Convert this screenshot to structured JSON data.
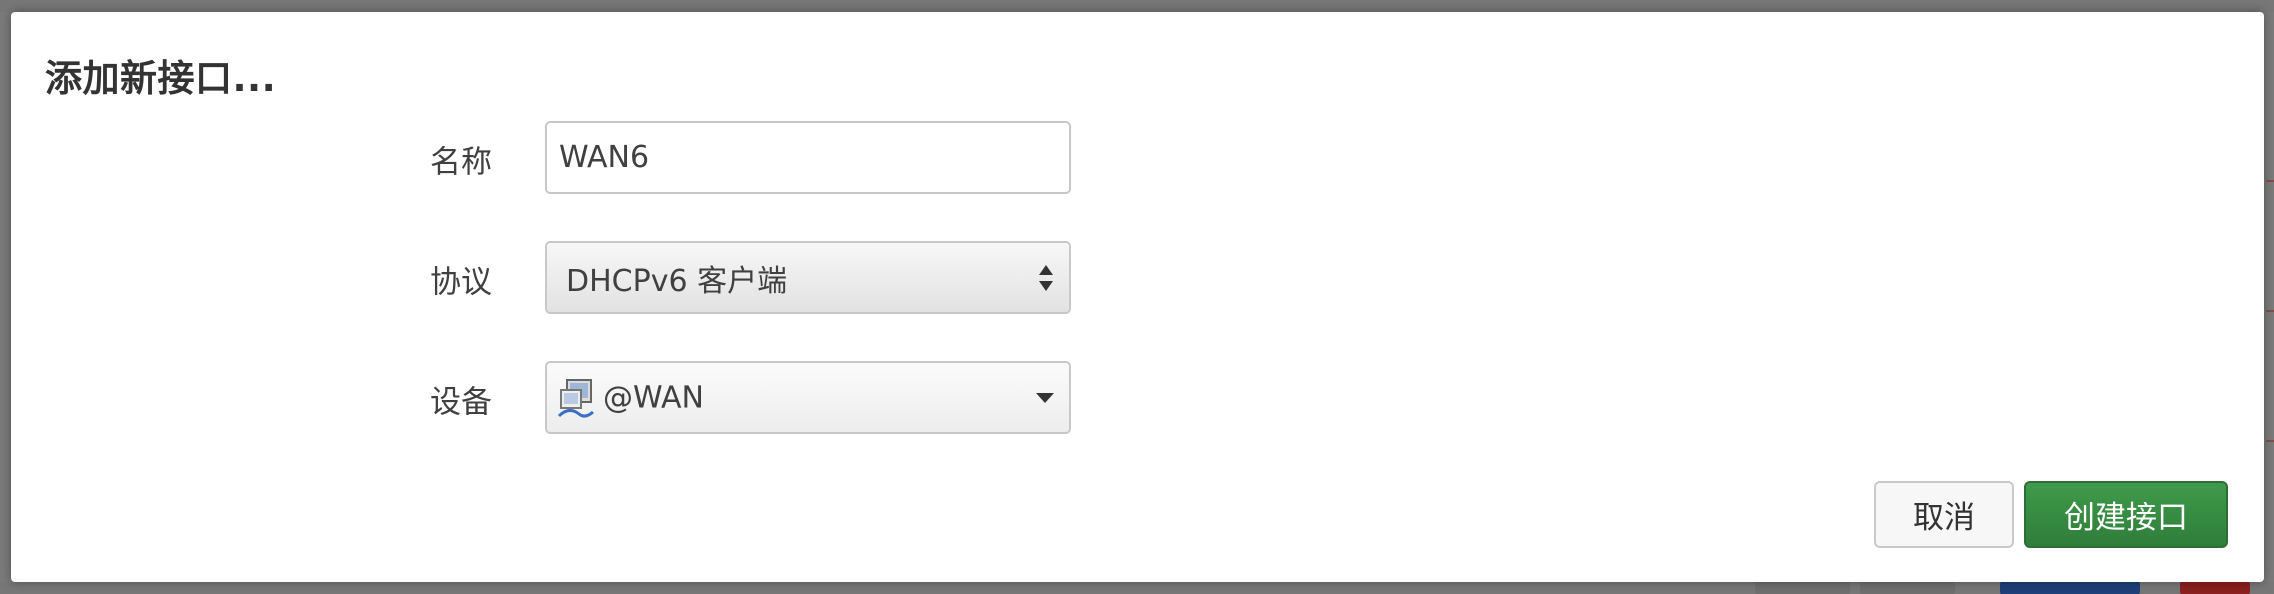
{
  "dialog": {
    "title": "添加新接口..."
  },
  "form": {
    "name": {
      "label": "名称",
      "value": "WAN6"
    },
    "protocol": {
      "label": "协议",
      "value": "DHCPv6 客户端"
    },
    "device": {
      "label": "设备",
      "value": "@WAN",
      "icon": "network-interface-icon"
    }
  },
  "buttons": {
    "cancel": "取消",
    "create": "创建接口"
  },
  "colors": {
    "primary_button": "#2f7d3a",
    "overlay": "#7a7a7a"
  }
}
